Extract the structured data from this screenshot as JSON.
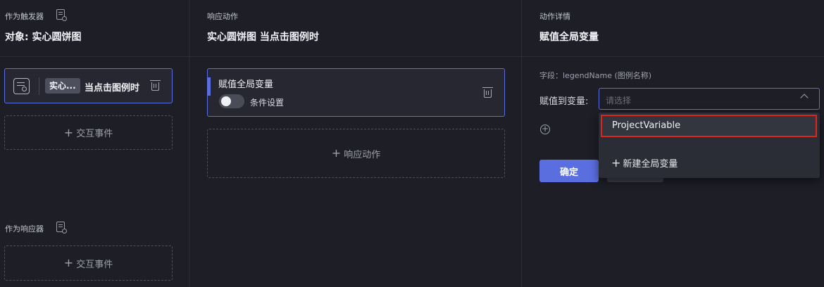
{
  "trigger_panel": {
    "section_label": "作为触发器",
    "object_title": "对象: 实心圆饼图",
    "card": {
      "tag": "实心...",
      "event": "当点击图例时"
    },
    "add_event": "交互事件",
    "responder_label": "作为响应器",
    "responder_add_event": "交互事件"
  },
  "response_panel": {
    "section_label": "响应动作",
    "title": "实心圆饼图 当点击图例时",
    "action": {
      "title": "赋值全局变量",
      "condition_label": "条件设置",
      "condition_enabled": false
    },
    "add_action": "响应动作"
  },
  "detail_panel": {
    "section_label": "动作详情",
    "title": "赋值全局变量",
    "field_hint": "字段：legendName (图例名称)",
    "assign_label": "赋值到变量:",
    "select_placeholder": "请选择",
    "confirm_label": "确定",
    "dropdown": {
      "options": [
        "ProjectVariable"
      ],
      "new_variable": "新建全局变量"
    }
  },
  "colors": {
    "accent": "#5b6ee0",
    "background": "#1d1e26",
    "highlight_border": "#e0241b"
  }
}
